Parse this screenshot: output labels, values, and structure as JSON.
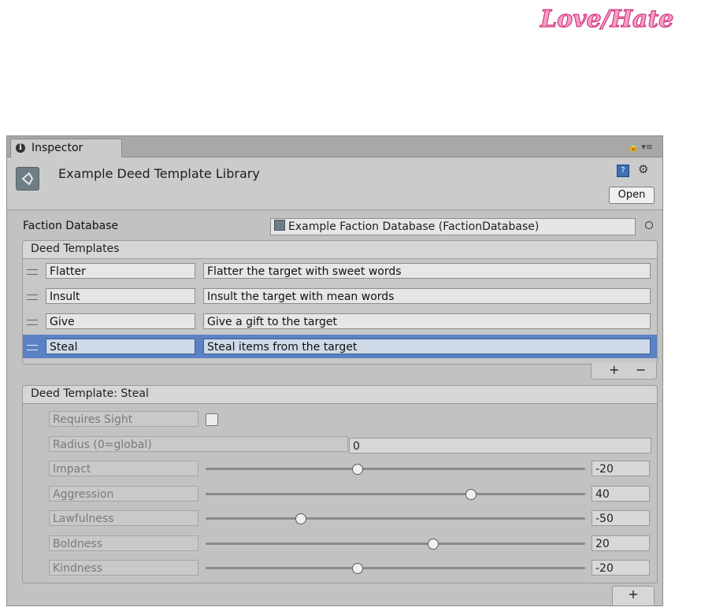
{
  "logo": {
    "text": "Love/Hate"
  },
  "tab": {
    "label": "Inspector"
  },
  "header": {
    "title": "Example Deed Template Library",
    "open_label": "Open"
  },
  "faction": {
    "label": "Faction Database",
    "value": "Example Faction Database (FactionDatabase)"
  },
  "deeds": {
    "header": "Deed Templates",
    "rows": [
      {
        "name": "Flatter",
        "description": "Flatter the target with sweet words"
      },
      {
        "name": "Insult",
        "description": "Insult the target with mean words"
      },
      {
        "name": "Give",
        "description": "Give a gift to the target"
      },
      {
        "name": "Steal",
        "description": "Steal items from the target"
      }
    ],
    "selected_index": 3,
    "add_label": "+",
    "remove_label": "−"
  },
  "detail": {
    "header": "Deed Template: Steal",
    "requires_sight": {
      "label": "Requires Sight",
      "checked": false
    },
    "radius": {
      "label": "Radius (0=global)",
      "value": "0"
    },
    "sliders": [
      {
        "label": "Impact",
        "value": "-20",
        "fraction": 0.4
      },
      {
        "label": "Aggression",
        "value": "40",
        "fraction": 0.7
      },
      {
        "label": "Lawfulness",
        "value": "-50",
        "fraction": 0.25
      },
      {
        "label": "Boldness",
        "value": "20",
        "fraction": 0.6
      },
      {
        "label": "Kindness",
        "value": "-20",
        "fraction": 0.4
      }
    ]
  },
  "add_component_label": "+"
}
